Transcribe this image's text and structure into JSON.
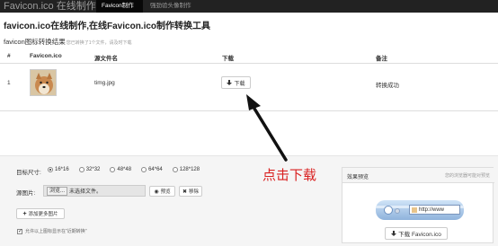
{
  "navbar": {
    "brand": "Favicon.ico 在线制作",
    "tabs": [
      {
        "label": "Favicon制作",
        "active": true
      },
      {
        "label": "强劲验头像制作",
        "active": false
      }
    ]
  },
  "page": {
    "title": "favicon.ico在线制作,在线Favicon.ico制作转换工具"
  },
  "results": {
    "title": "favicon图标转换结果",
    "subtitle": "您已转换了1个文件，请及时下载",
    "columns": [
      "#",
      "Favicon.ico",
      "源文件名",
      "下载",
      "备注"
    ],
    "rows": [
      {
        "index": "1",
        "filename": "timg.jpg",
        "download_label": "下载",
        "note": "转换成功"
      }
    ]
  },
  "form": {
    "size_label": "目标尺寸:",
    "sizes": [
      {
        "label": "16*16",
        "checked": true
      },
      {
        "label": "32*32",
        "checked": false
      },
      {
        "label": "48*48",
        "checked": false
      },
      {
        "label": "64*64",
        "checked": false
      },
      {
        "label": "128*128",
        "checked": false
      }
    ],
    "source_label": "源图片:",
    "browse_label": "浏览...",
    "file_status": "未选择文件。",
    "preview_btn": "预览",
    "remove_btn": "移除",
    "add_btn": "添加更多图片",
    "checkbox_label": "允许以上图标显示在\"近期转换\"",
    "checkbox_checked": true
  },
  "preview": {
    "title": "效果预览",
    "note": "您的浏览器可能对预览",
    "address": "http://www",
    "download_label": "下载 Favicon.ico"
  },
  "annotation": {
    "text": "点击下载",
    "color": "#d92020"
  }
}
